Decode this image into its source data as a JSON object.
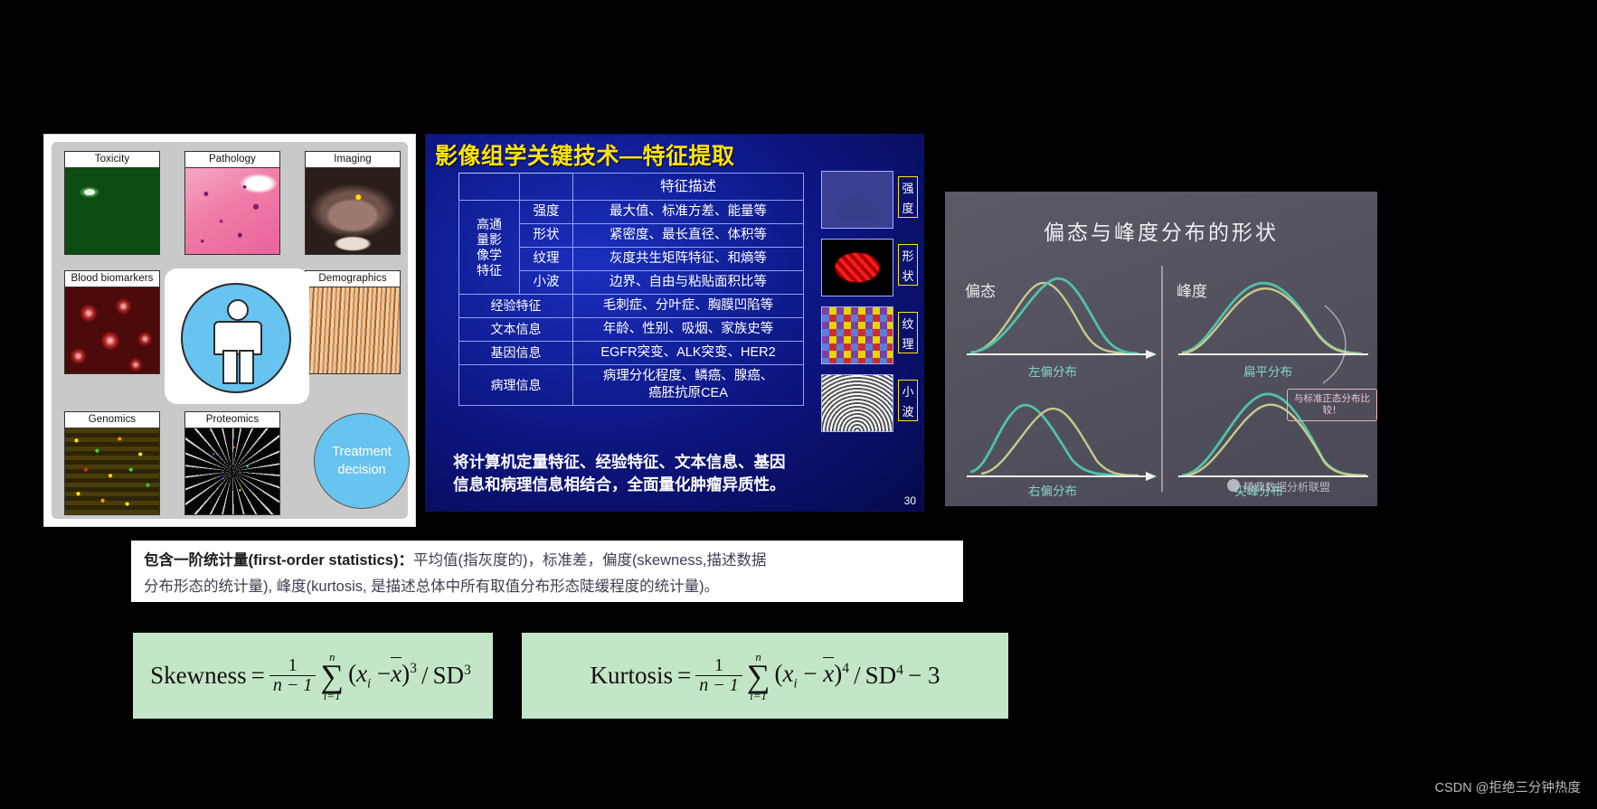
{
  "omics_panel": {
    "cells": [
      {
        "label": "Toxicity"
      },
      {
        "label": "Pathology"
      },
      {
        "label": "Imaging"
      },
      {
        "label": "Blood biomarkers"
      },
      {
        "label": "Demographics"
      },
      {
        "label": "Genomics"
      },
      {
        "label": "Proteomics"
      }
    ],
    "treatment": {
      "line1": "Treatment",
      "line2": "decision"
    }
  },
  "slide": {
    "title": "影像组学关键技术—特征提取",
    "page_number": "30",
    "table": {
      "header_blank": "",
      "header_desc": "特征描述",
      "rows": [
        {
          "group": "高通量影像学特征",
          "sub": "强度",
          "desc": "最大值、标准方差、能量等"
        },
        {
          "group": "",
          "sub": "形状",
          "desc": "紧密度、最长直径、体积等"
        },
        {
          "group": "",
          "sub": "纹理",
          "desc": "灰度共生矩阵特征、和熵等"
        },
        {
          "group": "",
          "sub": "小波",
          "desc": "边界、自由与粘贴面积比等"
        },
        {
          "group": "经验特征",
          "sub": "",
          "desc": "毛刺症、分叶症、胸膜凹陷等"
        },
        {
          "group": "文本信息",
          "sub": "",
          "desc": "年龄、性别、吸烟、家族史等"
        },
        {
          "group": "基因信息",
          "sub": "",
          "desc": "EGFR突变、ALK突变、HER2"
        },
        {
          "group": "病理信息",
          "sub": "",
          "desc": "病理分化程度、鳞癌、腺癌、癌胚抗原CEA"
        }
      ],
      "group_cell_label": "高通\n量影\n像学\n特征"
    },
    "summary_line1": "将计算机定量特征、经验特征、文本信息、基因",
    "summary_line2": "信息和病理信息相结合，全面量化肿瘤异质性。",
    "thumbnails": [
      {
        "label": "强度",
        "icon": "histogram-thumbnail"
      },
      {
        "label": "形状",
        "icon": "shape-3d-thumbnail"
      },
      {
        "label": "纹理",
        "icon": "texture-matrix-thumbnail"
      },
      {
        "label": "小波",
        "icon": "wavelet-thumbnail"
      }
    ]
  },
  "distribution": {
    "title": "偏态与峰度分布的形状",
    "left_label": "偏态",
    "right_label": "峰度",
    "captions": {
      "left_skew": "左偏分布",
      "right_skew": "右偏分布",
      "flat": "扁平分布",
      "peaked": "尖峰分布"
    },
    "note": "与标准正态分布比较！",
    "watermark": "精鼎数据分析联盟"
  },
  "description": {
    "line1_bold": "包含一阶统计量(first-order statistics)：",
    "line1_rest": "平均值(指灰度的)，标准差，偏度(skewness,描述数据",
    "line2": "分布形态的统计量), 峰度(kurtosis, 是描述总体中所有取值分布形态陡缓程度的统计量)。"
  },
  "formulas": {
    "skewness": {
      "name": "Skewness",
      "equals": "=",
      "frac_num": "1",
      "frac_den": "n − 1",
      "sigma_top": "n",
      "sigma_bottom": "i=1",
      "term": "(xi − x̄)",
      "power": "3",
      "slash": "/",
      "denominator": "SD",
      "denominator_power": "3",
      "tail": ""
    },
    "kurtosis": {
      "name": "Kurtosis",
      "equals": "=",
      "frac_num": "1",
      "frac_den": "n − 1",
      "sigma_top": "n",
      "sigma_bottom": "i=1",
      "term": "(xi − x̄)",
      "power": "4",
      "slash": "/",
      "denominator": "SD",
      "denominator_power": "4",
      "tail": "− 3"
    }
  },
  "watermark": "CSDN @拒绝三分钟热度"
}
